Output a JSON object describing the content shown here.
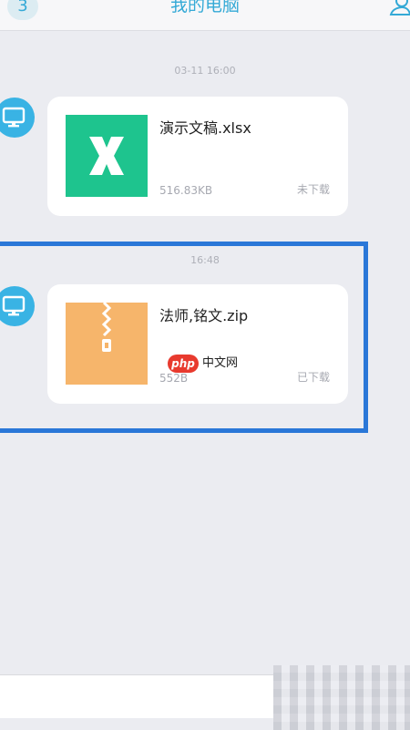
{
  "header": {
    "badge_count": "3",
    "title": "我的电脑",
    "contacts_icon": "contacts-icon"
  },
  "messages": [
    {
      "timestamp": "03-11 16:00",
      "avatar_icon": "monitor-icon",
      "file": {
        "name": "演示文稿.xlsx",
        "size": "516.83KB",
        "status": "未下载",
        "thumb_icon": "excel-file-icon",
        "thumb_color": "#1ec48e"
      }
    },
    {
      "timestamp": "16:48",
      "avatar_icon": "monitor-icon",
      "file": {
        "name": "法师,铭文.zip",
        "size": "552B",
        "status": "已下载",
        "thumb_icon": "zip-file-icon",
        "thumb_color": "#f6b56b"
      }
    }
  ],
  "watermark": {
    "badge": "php",
    "text": "中文网"
  },
  "colors": {
    "accent": "#34a9d6",
    "background": "#ebecf1",
    "highlight": "#2a77d8"
  }
}
